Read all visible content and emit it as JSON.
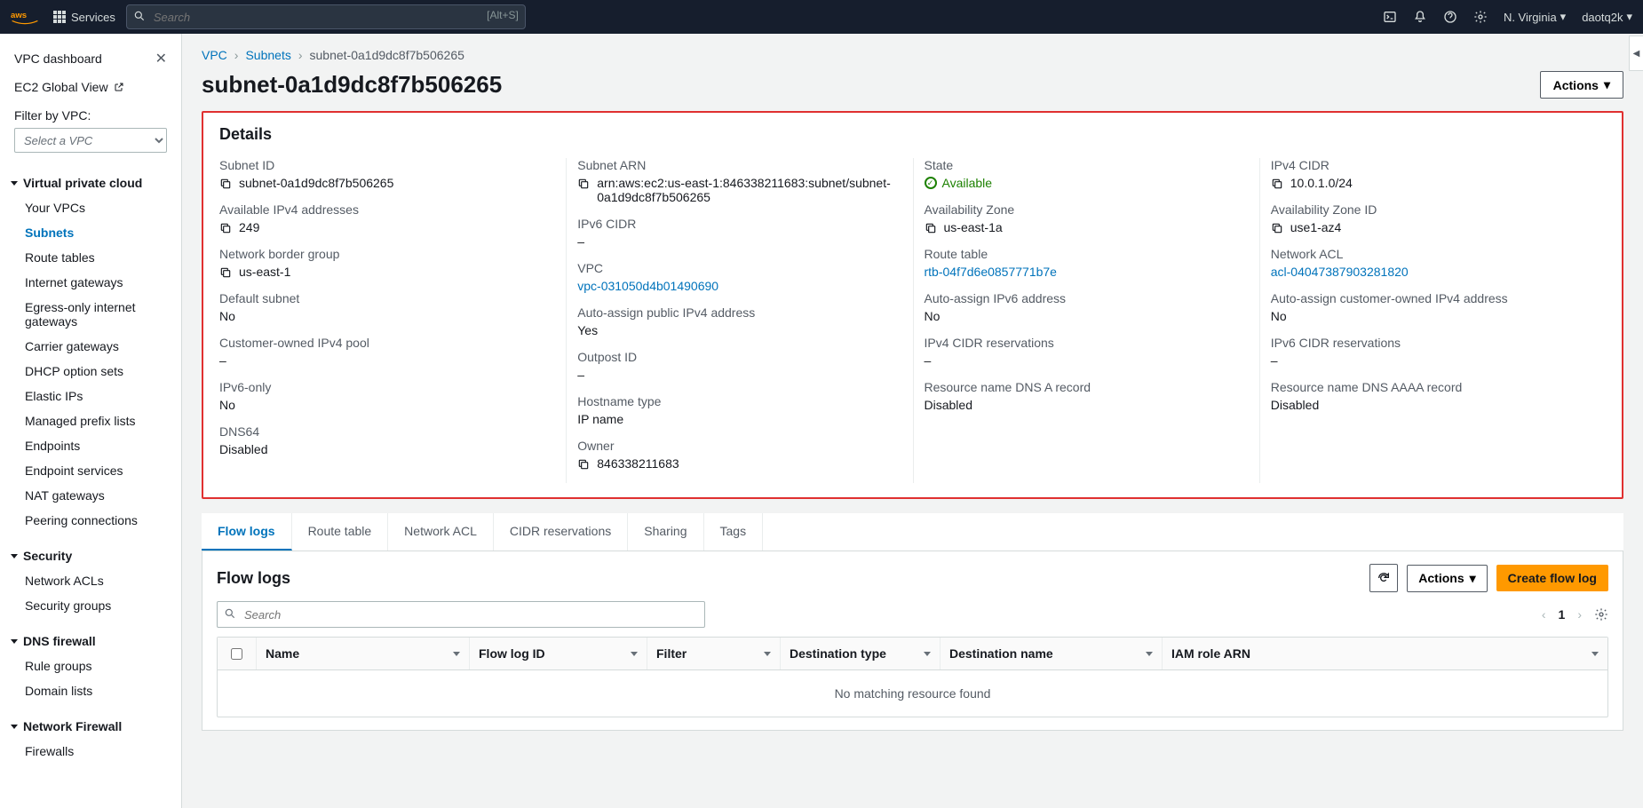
{
  "topnav": {
    "services": "Services",
    "search_placeholder": "Search",
    "search_shortcut": "[Alt+S]",
    "region": "N. Virginia",
    "user": "daotq2k"
  },
  "sidebar": {
    "title": "VPC dashboard",
    "ec2_global": "EC2 Global View",
    "filter_label": "Filter by VPC:",
    "filter_placeholder": "Select a VPC",
    "sections": [
      {
        "title": "Virtual private cloud",
        "items": [
          "Your VPCs",
          "Subnets",
          "Route tables",
          "Internet gateways",
          "Egress-only internet gateways",
          "Carrier gateways",
          "DHCP option sets",
          "Elastic IPs",
          "Managed prefix lists",
          "Endpoints",
          "Endpoint services",
          "NAT gateways",
          "Peering connections"
        ]
      },
      {
        "title": "Security",
        "items": [
          "Network ACLs",
          "Security groups"
        ]
      },
      {
        "title": "DNS firewall",
        "items": [
          "Rule groups",
          "Domain lists"
        ]
      },
      {
        "title": "Network Firewall",
        "items": [
          "Firewalls"
        ]
      }
    ],
    "active_item": "Subnets"
  },
  "breadcrumb": {
    "root": "VPC",
    "mid": "Subnets",
    "current": "subnet-0a1d9dc8f7b506265"
  },
  "page": {
    "title": "subnet-0a1d9dc8f7b506265",
    "actions_label": "Actions"
  },
  "details": {
    "title": "Details",
    "col1": [
      {
        "label": "Subnet ID",
        "value": "subnet-0a1d9dc8f7b506265",
        "copy": true
      },
      {
        "label": "Available IPv4 addresses",
        "value": "249",
        "copy": true
      },
      {
        "label": "Network border group",
        "value": "us-east-1",
        "copy": true
      },
      {
        "label": "Default subnet",
        "value": "No"
      },
      {
        "label": "Customer-owned IPv4 pool",
        "value": "–"
      },
      {
        "label": "IPv6-only",
        "value": "No"
      },
      {
        "label": "DNS64",
        "value": "Disabled"
      }
    ],
    "col2": [
      {
        "label": "Subnet ARN",
        "value": "arn:aws:ec2:us-east-1:846338211683:subnet/subnet-0a1d9dc8f7b506265",
        "copy": true
      },
      {
        "label": "IPv6 CIDR",
        "value": "–"
      },
      {
        "label": "VPC",
        "value": "vpc-031050d4b01490690",
        "link": true
      },
      {
        "label": "Auto-assign public IPv4 address",
        "value": "Yes"
      },
      {
        "label": "Outpost ID",
        "value": "–"
      },
      {
        "label": "Hostname type",
        "value": "IP name"
      },
      {
        "label": "Owner",
        "value": "846338211683",
        "copy": true
      }
    ],
    "col3": [
      {
        "label": "State",
        "value": "Available",
        "state": true
      },
      {
        "label": "Availability Zone",
        "value": "us-east-1a",
        "copy": true
      },
      {
        "label": "Route table",
        "value": "rtb-04f7d6e0857771b7e",
        "link": true
      },
      {
        "label": "Auto-assign IPv6 address",
        "value": "No"
      },
      {
        "label": "IPv4 CIDR reservations",
        "value": "–"
      },
      {
        "label": "Resource name DNS A record",
        "value": "Disabled"
      }
    ],
    "col4": [
      {
        "label": "IPv4 CIDR",
        "value": "10.0.1.0/24",
        "copy": true
      },
      {
        "label": "Availability Zone ID",
        "value": "use1-az4",
        "copy": true
      },
      {
        "label": "Network ACL",
        "value": "acl-04047387903281820",
        "link": true
      },
      {
        "label": "Auto-assign customer-owned IPv4 address",
        "value": "No"
      },
      {
        "label": "IPv6 CIDR reservations",
        "value": "–"
      },
      {
        "label": "Resource name DNS AAAA record",
        "value": "Disabled"
      }
    ]
  },
  "tabs": [
    "Flow logs",
    "Route table",
    "Network ACL",
    "CIDR reservations",
    "Sharing",
    "Tags"
  ],
  "active_tab": "Flow logs",
  "flowlogs": {
    "title": "Flow logs",
    "search_placeholder": "Search",
    "actions_label": "Actions",
    "create_label": "Create flow log",
    "page_num": "1",
    "columns": [
      "Name",
      "Flow log ID",
      "Filter",
      "Destination type",
      "Destination name",
      "IAM role ARN"
    ],
    "empty": "No matching resource found"
  },
  "col_widths": [
    "240px",
    "200px",
    "150px",
    "180px",
    "250px",
    "1fr"
  ]
}
